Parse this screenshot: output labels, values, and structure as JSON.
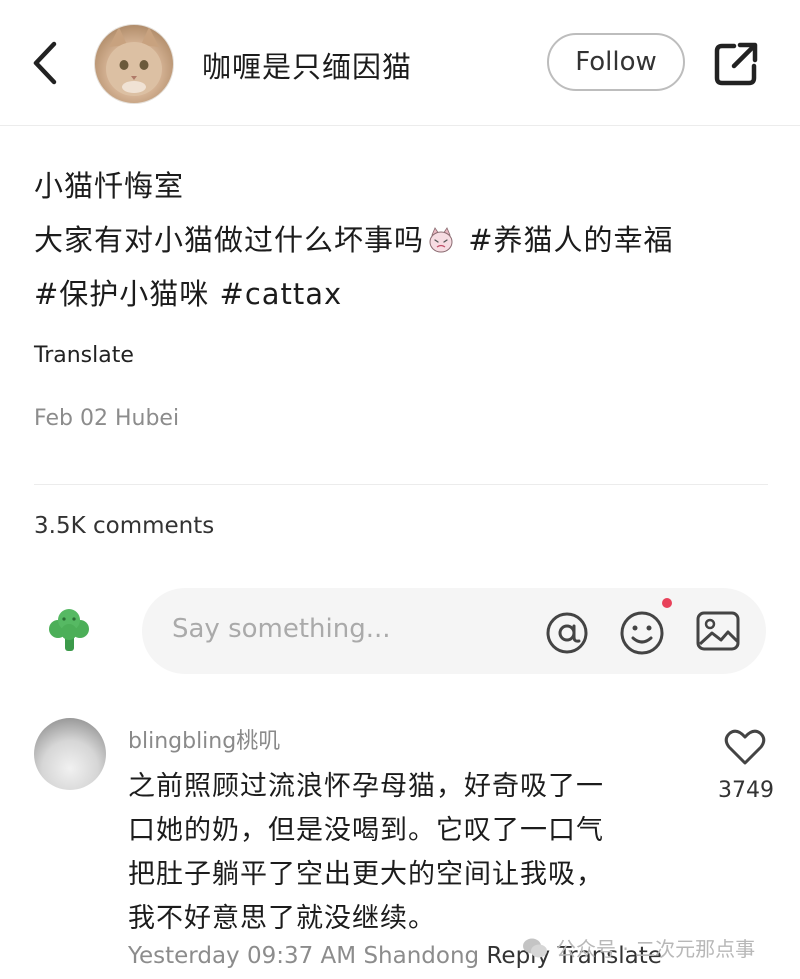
{
  "header": {
    "username": "咖喱是只缅因猫",
    "follow_label": "Follow"
  },
  "post": {
    "title": "小猫忏悔室",
    "body_line1_text": "大家有对小猫做过什么坏事吗",
    "hashtags": [
      "#养猫人的幸福",
      "#保护小猫咪",
      "#cattax"
    ],
    "translate_label": "Translate",
    "date": "Feb 02",
    "location": "Hubei"
  },
  "comments_summary": {
    "count_label": "3.5K comments"
  },
  "comment_input": {
    "placeholder": "Say something..."
  },
  "comment": {
    "username": "blingbling桃叽",
    "text_lines": [
      "之前照顾过流浪怀孕母猫，好奇吸了一",
      "口她的奶，但是没喝到。它叹了一口气",
      "把肚子躺平了空出更大的空间让我吸，",
      "我不好意思了就没继续。"
    ],
    "likes": "3749",
    "time": "Yesterday 09:37 AM",
    "location": "Shandong",
    "reply_label": "Reply",
    "translate_label": "Translate"
  },
  "watermark": {
    "text": "公众号 · 二次元那点事"
  },
  "colors": {
    "notify_dot": "#e8415a",
    "input_bg": "#f5f5f5",
    "meta_gray": "#8c8c8c"
  },
  "icons": [
    "chevron-left-icon",
    "share-icon",
    "broccoli-avatar-icon",
    "at-icon",
    "smiley-icon",
    "image-icon",
    "heart-icon",
    "wechat-icon",
    "crying-cat-emoji"
  ]
}
